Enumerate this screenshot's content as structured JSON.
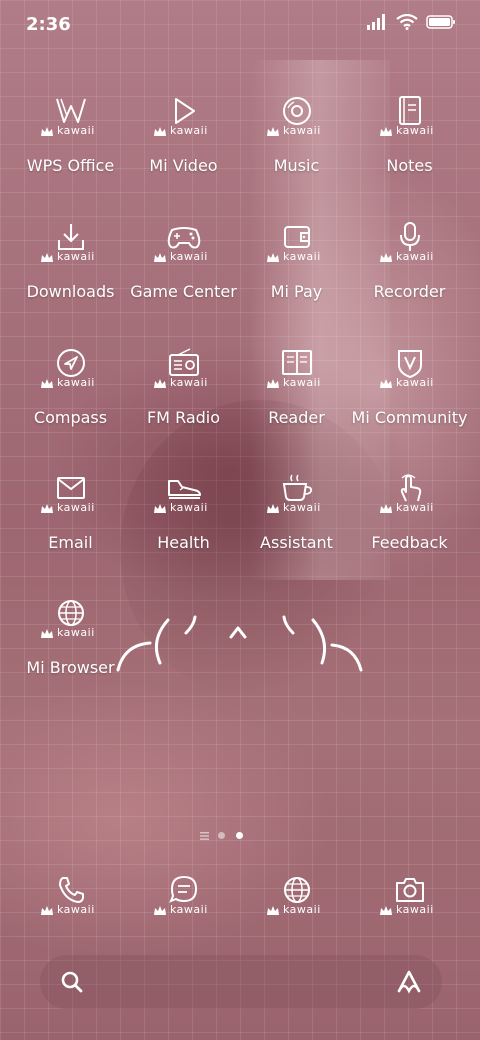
{
  "status_bar": {
    "time": "2:36",
    "icons": [
      "cellular-signal-icon",
      "wifi-icon",
      "battery-icon"
    ]
  },
  "badge_text": "kawaii",
  "apps": [
    {
      "label": "WPS Office",
      "icon": "wps-icon"
    },
    {
      "label": "Mi Video",
      "icon": "play-icon"
    },
    {
      "label": "Music",
      "icon": "disc-icon"
    },
    {
      "label": "Notes",
      "icon": "notebook-icon"
    },
    {
      "label": "Downloads",
      "icon": "download-icon"
    },
    {
      "label": "Game Center",
      "icon": "gamepad-icon"
    },
    {
      "label": "Mi Pay",
      "icon": "wallet-icon"
    },
    {
      "label": "Recorder",
      "icon": "microphone-icon"
    },
    {
      "label": "Compass",
      "icon": "compass-icon"
    },
    {
      "label": "FM Radio",
      "icon": "radio-icon"
    },
    {
      "label": "Reader",
      "icon": "book-icon"
    },
    {
      "label": "Mi Community",
      "icon": "community-badge-icon"
    },
    {
      "label": "Email",
      "icon": "envelope-icon"
    },
    {
      "label": "Health",
      "icon": "sneaker-icon"
    },
    {
      "label": "Assistant",
      "icon": "coffee-cup-icon"
    },
    {
      "label": "Feedback",
      "icon": "pointer-hand-icon"
    },
    {
      "label": "Mi Browser",
      "icon": "globe-icon"
    }
  ],
  "dock": [
    {
      "icon": "phone-icon"
    },
    {
      "icon": "message-icon"
    },
    {
      "icon": "globe-icon"
    },
    {
      "icon": "camera-icon"
    }
  ],
  "pager": {
    "pages": 2,
    "active": 2
  },
  "search": {
    "left_icon": "search-icon",
    "right_icon": "assistant-logo-icon"
  },
  "colors": {
    "accent": "#ffffff",
    "tint": "#a8727c"
  }
}
